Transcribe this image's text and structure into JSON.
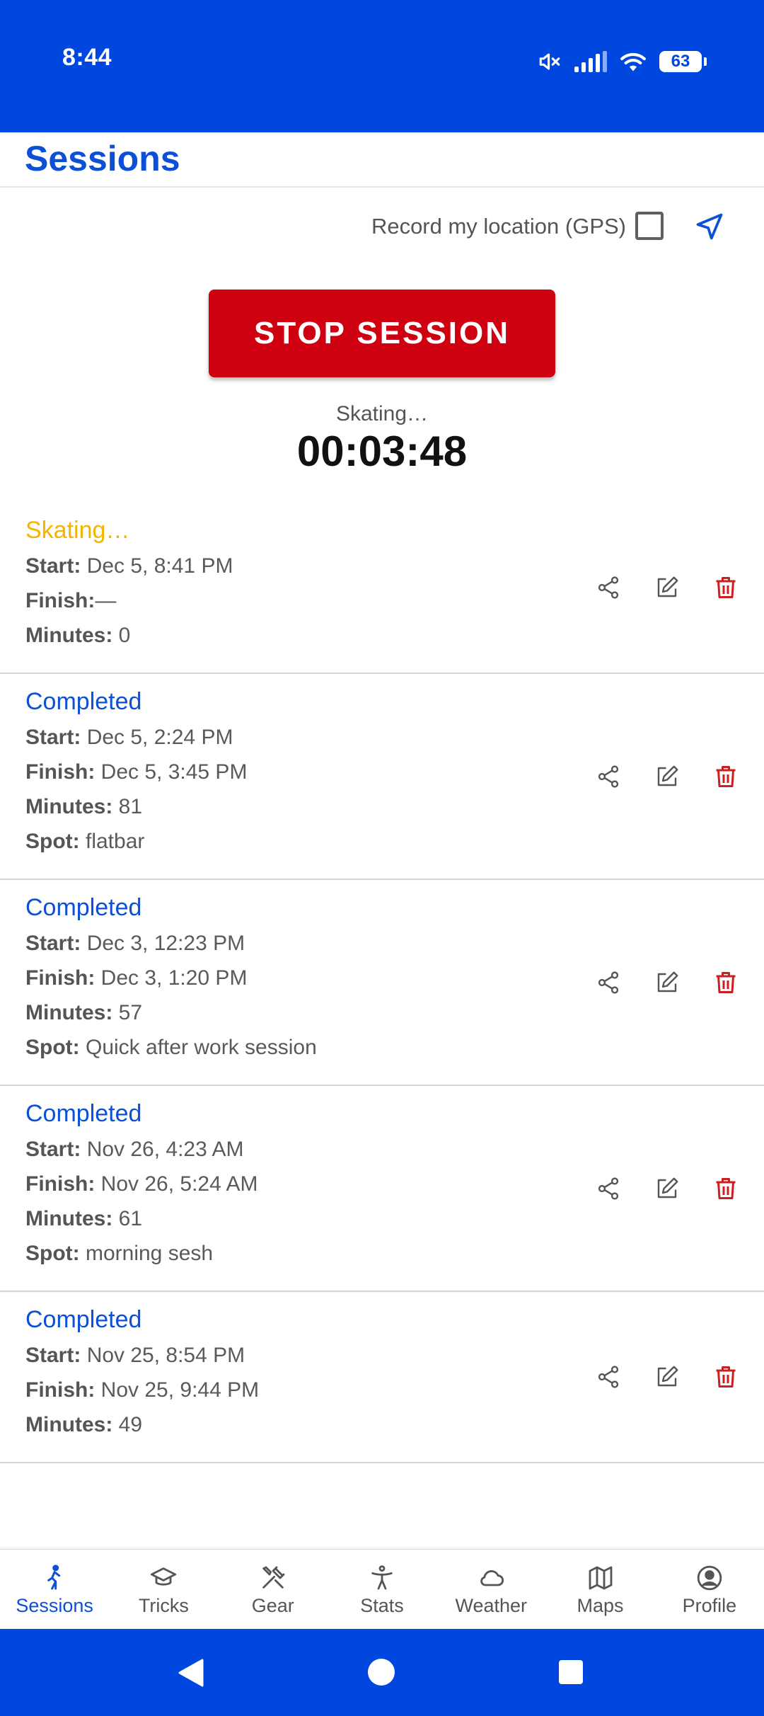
{
  "status_bar": {
    "time": "8:44",
    "battery": "63"
  },
  "header": {
    "title": "Sessions"
  },
  "gps": {
    "label": "Record my location (GPS)"
  },
  "controls": {
    "stop_label": "STOP SESSION"
  },
  "timer": {
    "status": "Skating…",
    "value": "00:03:48"
  },
  "labels": {
    "start": "Start:",
    "finish": "Finish:",
    "minutes": "Minutes:",
    "spot": "Spot:"
  },
  "sessions": [
    {
      "status": "Skating…",
      "start": "Dec 5, 8:41 PM",
      "finish": "—",
      "minutes": "0"
    },
    {
      "status": "Completed",
      "start": "Dec 5, 2:24 PM",
      "finish": "Dec 5, 3:45 PM",
      "minutes": "81",
      "spot": "flatbar"
    },
    {
      "status": "Completed",
      "start": "Dec 3, 12:23 PM",
      "finish": "Dec 3, 1:20 PM",
      "minutes": "57",
      "spot": "Quick after work session"
    },
    {
      "status": "Completed",
      "start": "Nov 26, 4:23 AM",
      "finish": "Nov 26, 5:24 AM",
      "minutes": "61",
      "spot": "morning sesh"
    },
    {
      "status": "Completed",
      "start": "Nov 25, 8:54 PM",
      "finish": "Nov 25, 9:44 PM",
      "minutes": "49"
    }
  ],
  "bottom_nav": [
    {
      "label": "Sessions",
      "icon": "skater-icon"
    },
    {
      "label": "Tricks",
      "icon": "graduation-cap-icon"
    },
    {
      "label": "Gear",
      "icon": "tools-icon"
    },
    {
      "label": "Stats",
      "icon": "accessibility-person-icon"
    },
    {
      "label": "Weather",
      "icon": "cloud-icon"
    },
    {
      "label": "Maps",
      "icon": "map-icon"
    },
    {
      "label": "Profile",
      "icon": "account-circle-icon"
    }
  ],
  "colors": {
    "brand": "#0047e0",
    "accent": "#0b50d6",
    "stop": "#cf000f",
    "active": "#f4b400",
    "delete": "#cc1f1f"
  }
}
